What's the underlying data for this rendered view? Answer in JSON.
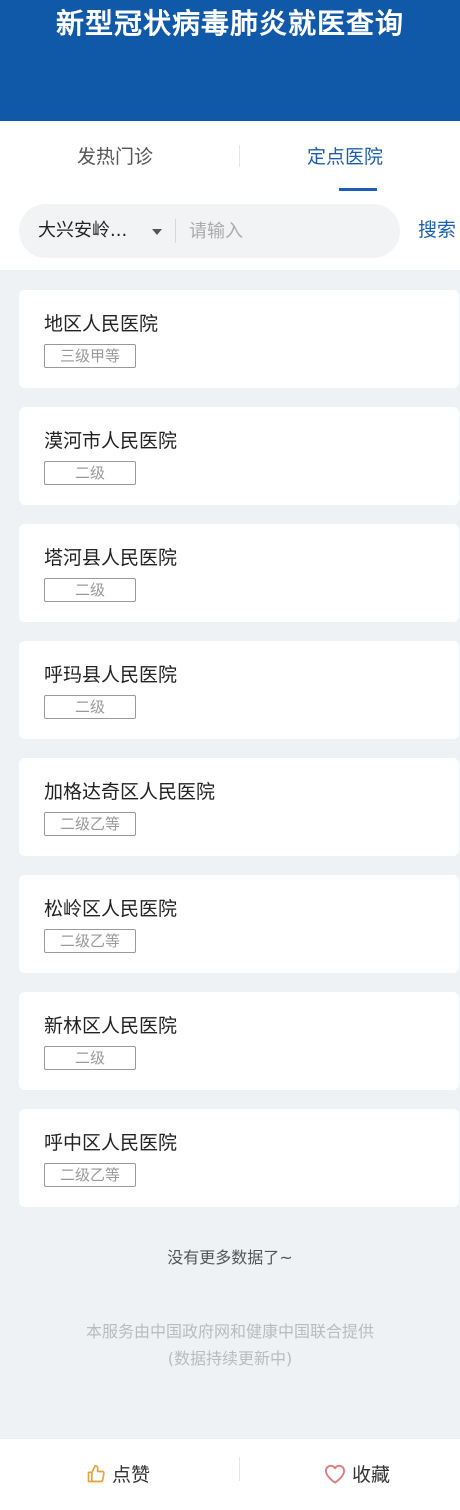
{
  "header": {
    "title": "新型冠状病毒肺炎就医查询"
  },
  "tabs": [
    {
      "label": "发热门诊"
    },
    {
      "label": "定点医院"
    }
  ],
  "search": {
    "region": "大兴安岭...",
    "placeholder": "请输入",
    "button": "搜索"
  },
  "hospitals": [
    {
      "name": "地区人民医院",
      "grade": "三级甲等"
    },
    {
      "name": "漠河市人民医院",
      "grade": "二级"
    },
    {
      "name": "塔河县人民医院",
      "grade": "二级"
    },
    {
      "name": "呼玛县人民医院",
      "grade": "二级"
    },
    {
      "name": "加格达奇区人民医院",
      "grade": "二级乙等"
    },
    {
      "name": "松岭区人民医院",
      "grade": "二级乙等"
    },
    {
      "name": "新林区人民医院",
      "grade": "二级"
    },
    {
      "name": "呼中区人民医院",
      "grade": "二级乙等"
    }
  ],
  "list_end": "没有更多数据了~",
  "footer": {
    "line1": "本服务由中国政府网和健康中国联合提供",
    "line2": "(数据持续更新中)"
  },
  "bottom_bar": {
    "like_label": "点赞",
    "like_icon": "thumbs-up-icon",
    "favorite_label": "收藏",
    "favorite_icon": "heart-icon"
  },
  "colors": {
    "brand_blue": "#1058a8",
    "accent_blue": "#1d5fae",
    "like_icon": "#e8a23a",
    "favorite_icon": "#e0787e"
  }
}
